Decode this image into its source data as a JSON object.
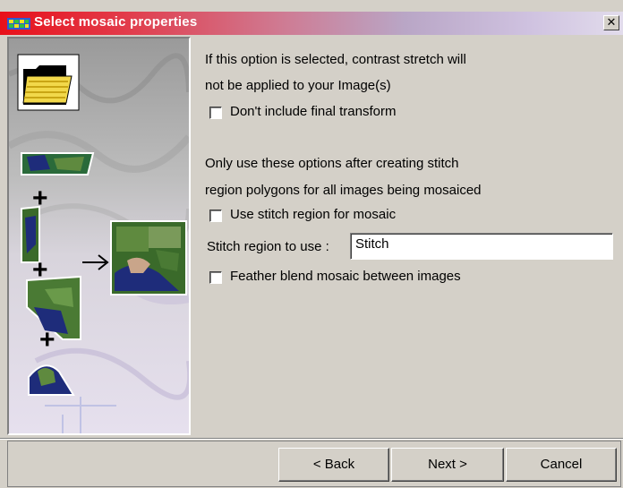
{
  "window": {
    "title": "Select mosaic properties",
    "close_icon": "close-icon"
  },
  "section1": {
    "line1": "If this option is selected, contrast stretch will",
    "line2": "not be applied to your Image(s)",
    "checkbox_label": "Don't include final transform",
    "checked": false
  },
  "section2": {
    "line1": "Only use these options after creating stitch",
    "line2": "region polygons for all images being mosaiced",
    "stitch_checkbox_label": "Use stitch region for mosaic",
    "stitch_checked": false,
    "stitch_field_label": "Stitch region to use :",
    "stitch_field_value": "Stitch",
    "feather_checkbox_label": "Feather blend mosaic between images",
    "feather_checked": false
  },
  "buttons": {
    "back": "< Back",
    "next": "Next >",
    "cancel": "Cancel"
  },
  "colors": {
    "title_start": "#e8101a",
    "title_end": "#e2dcec",
    "dialog_bg": "#d4d0c8"
  }
}
